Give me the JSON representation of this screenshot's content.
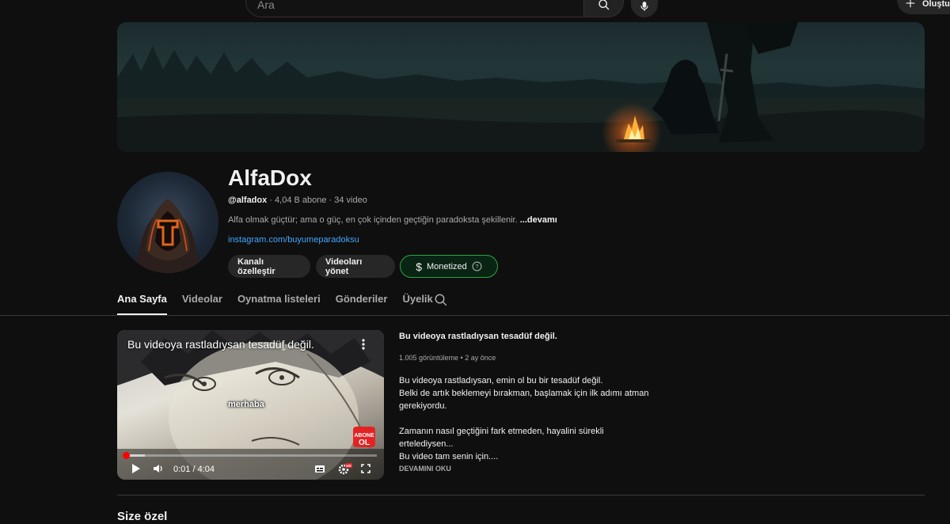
{
  "search": {
    "placeholder": "Ara"
  },
  "header": {
    "create_label": "Oluştur"
  },
  "channel": {
    "name": "AlfaDox",
    "handle": "@alfadox",
    "meta": " · 4,04 B abone · 34 video",
    "description": "Alfa olmak güçtür; ama o güç, en çok içinden geçtiğin paradoksta şekillenir. ",
    "description_more": "...devamı",
    "link": "instagram.com/buyumeparadoksu",
    "buttons": {
      "customize": "Kanalı özelleştir",
      "manage": "Videoları yönet",
      "monetized": "Monetized"
    }
  },
  "tabs": [
    {
      "label": "Ana Sayfa",
      "active": true
    },
    {
      "label": "Videolar"
    },
    {
      "label": "Oynatma listeleri"
    },
    {
      "label": "Gönderiler"
    },
    {
      "label": "Üyelik"
    }
  ],
  "featured": {
    "player_title": "Bu videoya rastladıysan tesadüf değil.",
    "caption": "merhaba",
    "badge_top": "ABONE",
    "badge_bottom": "OL",
    "time": "0:01 / 4:04",
    "progress": 0.004,
    "buffered": 0.08,
    "title": "Bu videoya rastladıysan tesadüf değil.",
    "meta": "1.005 görüntüleme • 2 ay önce",
    "description_lines": [
      "Bu videoya rastladıysan, emin ol bu bir tesadüf değil.",
      "Belki de artık beklemeyi bırakman, başlamak için ilk adımı atman",
      "gerekiyordu.",
      "",
      "Zamanın nasıl geçtiğini fark etmeden, hayalini sürekli",
      "ertelediysen...",
      "Bu video tam senin için...."
    ],
    "more_label": "DEVAMINI OKU"
  },
  "sections": {
    "for_you_title": "Size özel"
  },
  "colors": {
    "accent_red": "#ff0000",
    "link_blue": "#3ea6ff",
    "monetized_green": "#2ba640"
  }
}
